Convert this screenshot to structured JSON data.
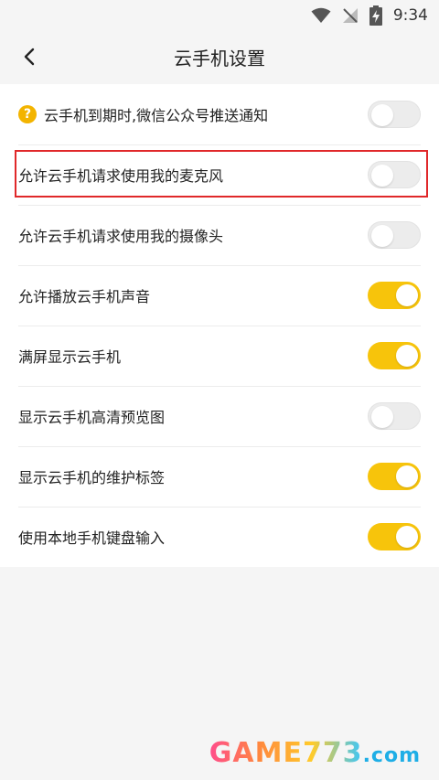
{
  "status": {
    "time": "9:34"
  },
  "header": {
    "title": "云手机设置",
    "back_icon": "chevron-left-icon"
  },
  "settings": [
    {
      "label": "云手机到期时,微信公众号推送通知",
      "on": false,
      "help": "?"
    },
    {
      "label": "允许云手机请求使用我的麦克风",
      "on": false,
      "highlighted": true
    },
    {
      "label": "允许云手机请求使用我的摄像头",
      "on": false
    },
    {
      "label": "允许播放云手机声音",
      "on": true
    },
    {
      "label": "满屏显示云手机",
      "on": true
    },
    {
      "label": "显示云手机高清预览图",
      "on": false
    },
    {
      "label": "显示云手机的维护标签",
      "on": true
    },
    {
      "label": "使用本地手机键盘输入",
      "on": true
    }
  ],
  "watermark": {
    "main": "GAME773",
    "suffix": ".com"
  },
  "colors": {
    "toggle_on": "#f7c40b",
    "toggle_off": "#ececec",
    "highlight": "#e0282a",
    "help": "#f3b400"
  }
}
